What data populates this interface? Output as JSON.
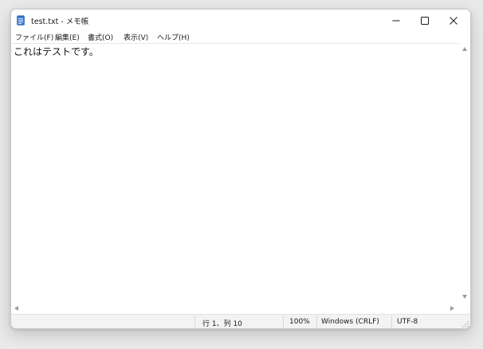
{
  "window": {
    "title": "test.txt - メモ帳"
  },
  "titlebar": {
    "app_icon": "notepad-icon",
    "buttons": {
      "minimize": "minimize-icon",
      "maximize": "maximize-icon",
      "close": "close-icon"
    }
  },
  "menu": {
    "items": [
      {
        "label": "ファイル(F)"
      },
      {
        "label": "編集(E)"
      },
      {
        "label": "書式(O)"
      },
      {
        "label": "表示(V)"
      },
      {
        "label": "ヘルプ(H)"
      }
    ]
  },
  "editor": {
    "content": "これはテストです。"
  },
  "statusbar": {
    "position": "行 1、列 10",
    "zoom": "100%",
    "line_ending": "Windows (CRLF)",
    "encoding": "UTF-8"
  },
  "colors": {
    "background": "#ffffff",
    "statusbar": "#f3f3f3",
    "icon_blue": "#2b6cc4"
  }
}
